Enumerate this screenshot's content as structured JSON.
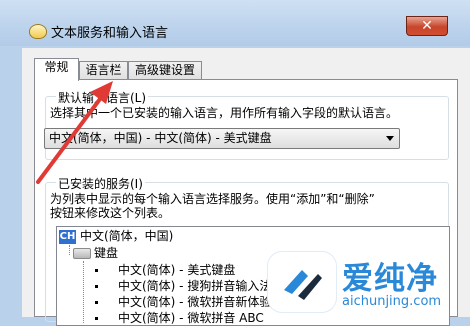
{
  "window": {
    "title": "文本服务和输入语言",
    "close_glyph": "✕"
  },
  "tabs": [
    {
      "label": "常规",
      "active": true
    },
    {
      "label": "语言栏",
      "active": false
    },
    {
      "label": "高级键设置",
      "active": false
    }
  ],
  "default_language": {
    "group_label": "默认输入语言(L)",
    "description": "选择其中一个已安装的输入语言，用作所有输入字段的默认语言。",
    "selected": "中文(简体，中国) - 中文(简体) - 美式键盘"
  },
  "installed_services": {
    "group_label": "已安装的服务(I)",
    "description_line1": "为列表中显示的每个输入语言选择服务。使用“添加”和“删除”",
    "description_line2": "按钮来修改这个列表。",
    "language_code": "CH",
    "language": "中文(简体，中国)",
    "category": "键盘",
    "items": [
      "中文(简体) - 美式键盘",
      "中文(简体) - 搜狗拼音输入法",
      "中文(简体) - 微软拼音新体验",
      "中文(简体) - 微软拼音 ABC"
    ]
  },
  "watermark": {
    "title": "爱纯净",
    "url": "aichunjing.com"
  },
  "colors": {
    "arrow": "#e03a35",
    "watermark": "#2a88d8",
    "selected_lang_icon": "#2f6fd0"
  },
  "icons": {
    "app": "keyboard-app-icon",
    "close": "close-icon",
    "language": "ch-language-icon",
    "keyboard": "keyboard-icon",
    "dropdown": "chevron-down-icon"
  }
}
